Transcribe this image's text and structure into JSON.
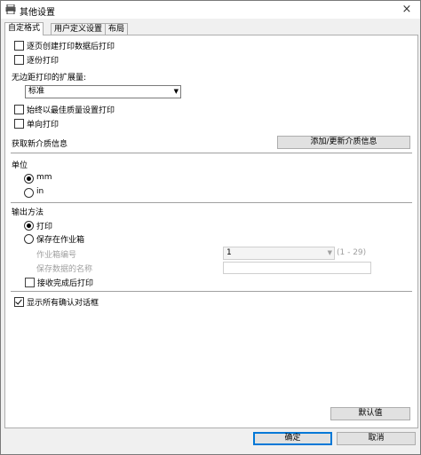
{
  "window": {
    "title": "其他设置",
    "close_icon": "×"
  },
  "tabs": [
    {
      "label": "自定格式",
      "active": true
    },
    {
      "label": "用户定义设置",
      "active": false
    },
    {
      "label": "布局",
      "active": false
    }
  ],
  "checkboxes_top": [
    {
      "label": "逐页创建打印数据后打印",
      "checked": false
    },
    {
      "label": "逐份打印",
      "checked": false
    }
  ],
  "borderless": {
    "label": "无边距打印的扩展量:",
    "selected": "标准"
  },
  "checkboxes_mid": [
    {
      "label": "始终以最佳质量设置打印",
      "checked": false
    },
    {
      "label": "单向打印",
      "checked": false
    }
  ],
  "media_info": {
    "label": "获取新介质信息",
    "button": "添加/更新介质信息"
  },
  "unit": {
    "heading": "单位",
    "options": [
      {
        "label": "mm",
        "selected": true
      },
      {
        "label": "in",
        "selected": false
      }
    ]
  },
  "output": {
    "heading": "输出方法",
    "options": [
      {
        "label": "打印",
        "selected": true
      },
      {
        "label": "保存在作业箱",
        "selected": false
      }
    ],
    "job_box_label": "作业箱编号",
    "job_box_value": "1",
    "job_box_range": "(1 - 29)",
    "data_name_label": "保存数据的名称",
    "data_name_value": "",
    "print_after_receive": {
      "label": "接收完成后打印",
      "checked": false
    }
  },
  "show_dialogs": {
    "label": "显示所有确认对话框",
    "checked": true
  },
  "buttons": {
    "defaults": "默认值",
    "ok": "确定",
    "cancel": "取消"
  }
}
